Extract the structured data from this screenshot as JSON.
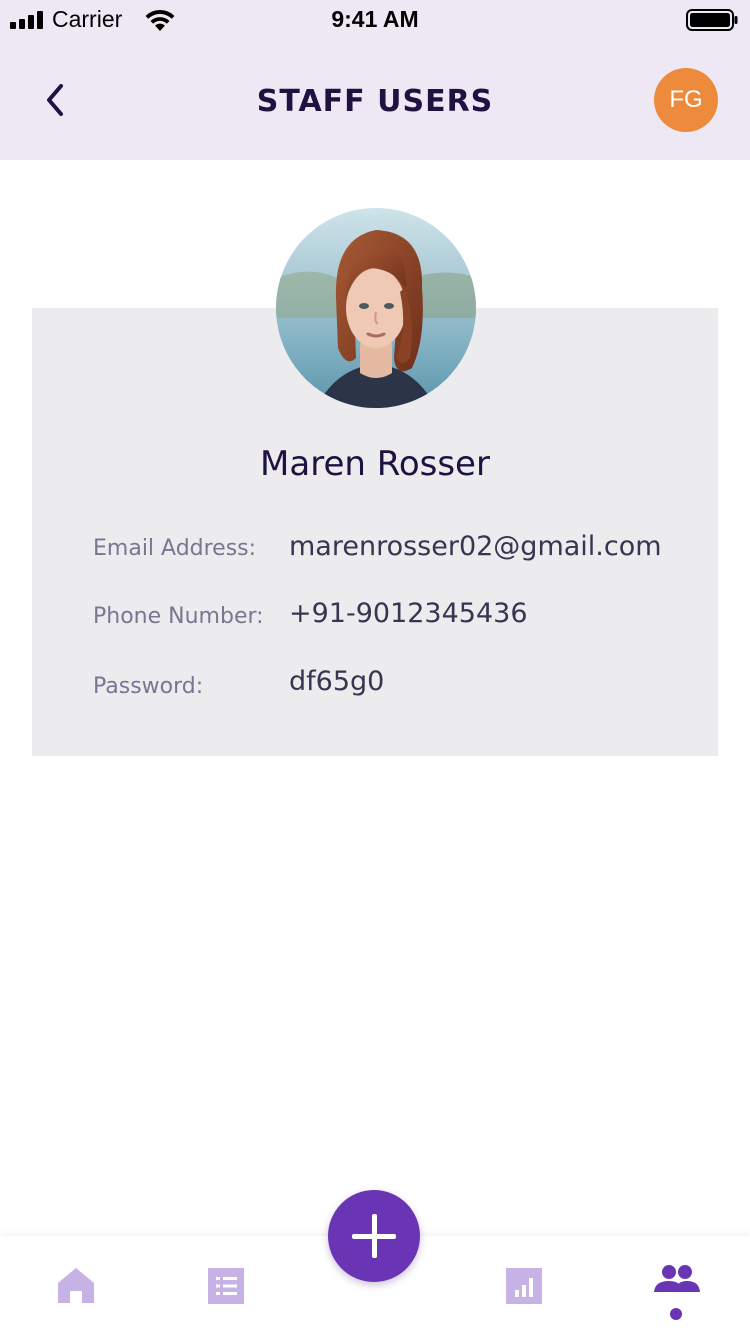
{
  "status_bar": {
    "carrier": "Carrier",
    "time": "9:41 AM"
  },
  "header": {
    "title": "STAFF USERS",
    "avatar_initials": "FG",
    "avatar_color": "#ee8a3c"
  },
  "profile": {
    "name": "Maren Rosser",
    "fields": [
      {
        "label": "Email Address:",
        "value": "marenrosser02@gmail.com"
      },
      {
        "label": "Phone Number:",
        "value": "+91-9012345436"
      },
      {
        "label": "Password:",
        "value": "df65g0"
      }
    ]
  },
  "tab_bar": {
    "tabs": [
      {
        "icon": "home-icon"
      },
      {
        "icon": "list-icon"
      },
      {
        "icon": "add-icon"
      },
      {
        "icon": "bar-chart-icon"
      },
      {
        "icon": "users-icon",
        "active": true
      }
    ],
    "accent": "#6a35b5",
    "inactive": "#c6b2e4"
  }
}
